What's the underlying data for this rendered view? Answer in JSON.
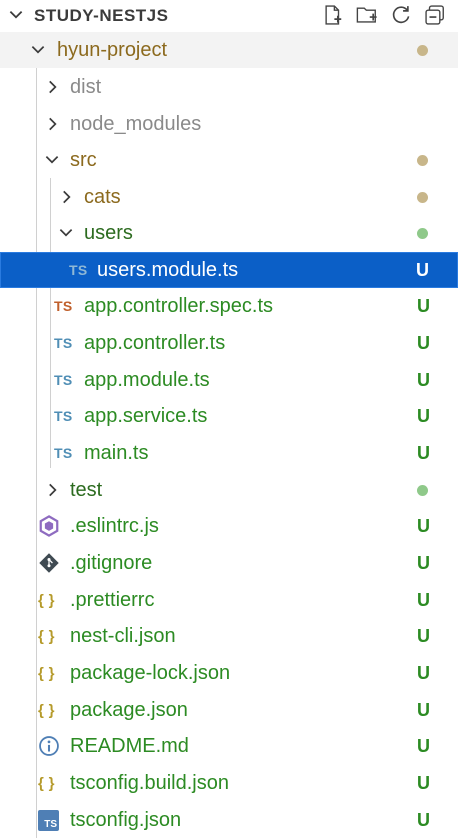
{
  "header": {
    "title": "STUDY-NESTJS"
  },
  "colors": {
    "folder": "#8c6a1e",
    "untracked": "#2c8b23",
    "ignored": "#8a8a8a",
    "selected_bg": "#0b5fc7",
    "ts_blue": "#4f8eb5",
    "ts_spec": "#c0602c"
  },
  "tree": {
    "project": "hyun-project",
    "dist": "dist",
    "node_modules": "node_modules",
    "src": "src",
    "cats": "cats",
    "users": "users",
    "users_module": "users.module.ts",
    "app_controller_spec": "app.controller.spec.ts",
    "app_controller": "app.controller.ts",
    "app_module": "app.module.ts",
    "app_service": "app.service.ts",
    "main": "main.ts",
    "test": "test",
    "eslintrc": ".eslintrc.js",
    "gitignore": ".gitignore",
    "prettierrc": ".prettierrc",
    "nest_cli": "nest-cli.json",
    "package_lock": "package-lock.json",
    "package": "package.json",
    "readme": "README.md",
    "tsconfig_build": "tsconfig.build.json",
    "tsconfig": "tsconfig.json"
  },
  "badges": {
    "ts": "TS",
    "untracked": "U",
    "json_icon": "{ }"
  }
}
